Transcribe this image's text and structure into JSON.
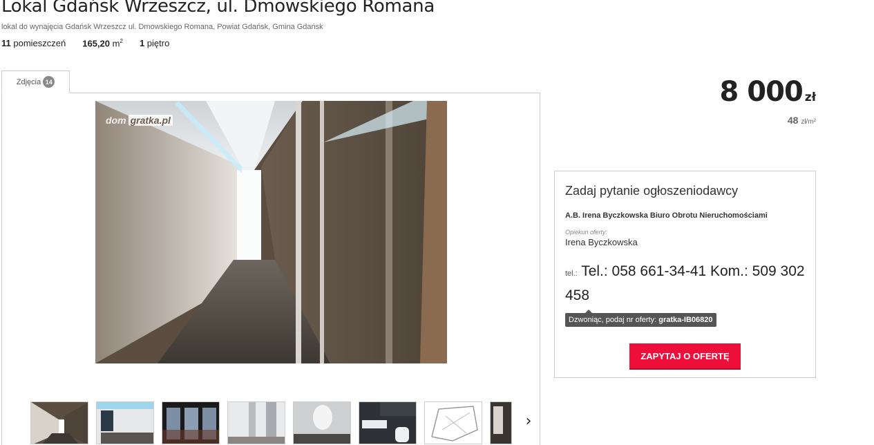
{
  "listing": {
    "title": "Lokal Gdańsk Wrzeszcz, ul. Dmowskiego Romana",
    "subtitle": "lokal do wynajęcia Gdańsk Wrzeszcz ul. Dmowskiego Romana, Powiat Gdańsk, Gmina Gdańsk",
    "params": {
      "rooms_value": "11",
      "rooms_label": "pomieszczeń",
      "area_value": "165,20",
      "area_unit": "m",
      "area_sup": "2",
      "floor_value": "1",
      "floor_label": "piętro"
    }
  },
  "gallery": {
    "tab_label": "Zdjęcia",
    "photo_count": "14",
    "watermark_left": "dom",
    "watermark_box": "gratka",
    "watermark_suffix": ".pl",
    "thumb_icons": [
      "corridor-thumb",
      "office-window-thumb",
      "window-view-thumb",
      "glass-corridor-thumb",
      "lit-room-thumb",
      "bathroom-thumb",
      "floorplan-thumb",
      "partial-thumb"
    ],
    "next_icon": "chevron-right-icon",
    "next_glyph": "›"
  },
  "price": {
    "amount": "8 000",
    "currency": "zł",
    "per_m2_value": "48",
    "per_m2_unit": "zł/m²"
  },
  "contact": {
    "title": "Zadaj pytanie ogłoszeniodawcy",
    "agency": "A.B. Irena Byczkowska Biuro Obrotu Nieruchomościami",
    "guardian_label": "Opiekun oferty:",
    "guardian_name": "Irena Byczkowska",
    "tel_label": "tel.:",
    "phone": "Tel.: 058 661-34-41 Kom.: 509 302 458",
    "tooltip_prefix": "Dzwoniąc, podaj nr oferty:",
    "offer_number": "gratka-IB06820",
    "ask_button": "ZAPYTAJ O OFERTĘ"
  },
  "colors": {
    "accent": "#ee0e3a",
    "badge": "#888888",
    "tooltip_bg": "#555555"
  }
}
